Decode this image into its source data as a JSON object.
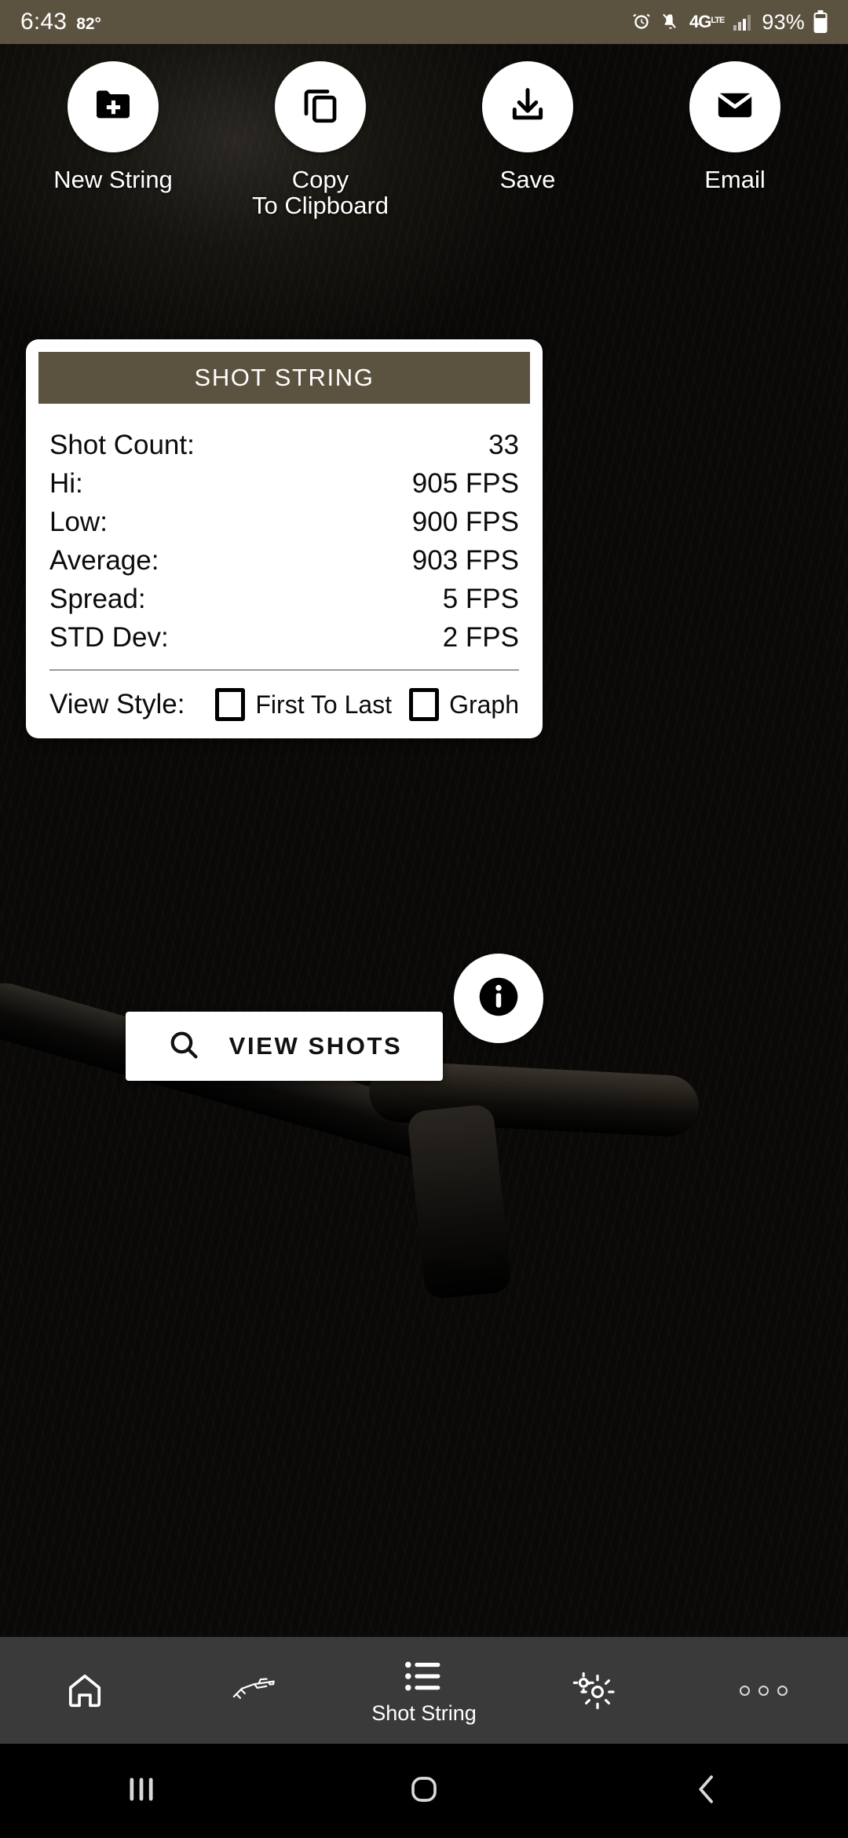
{
  "status_bar": {
    "time": "6:43",
    "temperature": "82°",
    "network": "4G",
    "network_sup": "LTE",
    "battery_percent": "93%",
    "icons": [
      "alarm-icon",
      "mute-icon",
      "network-4glte-icon",
      "signal-bars-icon",
      "battery-icon"
    ]
  },
  "actions": [
    {
      "label": "New String",
      "icon": "folder-plus-icon"
    },
    {
      "label": "Copy\nTo Clipboard",
      "icon": "copy-icon"
    },
    {
      "label": "Save",
      "icon": "download-icon"
    },
    {
      "label": "Email",
      "icon": "envelope-icon"
    }
  ],
  "card": {
    "title": "SHOT STRING",
    "header_color": "#5c5240",
    "stats": [
      {
        "label": "Shot Count:",
        "value": "33"
      },
      {
        "label": "Hi:",
        "value": "905 FPS"
      },
      {
        "label": "Low:",
        "value": "900 FPS"
      },
      {
        "label": "Average:",
        "value": "903 FPS"
      },
      {
        "label": "Spread:",
        "value": "5 FPS"
      },
      {
        "label": "STD Dev:",
        "value": "2 FPS"
      }
    ],
    "view_style": {
      "label": "View Style:",
      "options": [
        {
          "label": "First To Last",
          "checked": false
        },
        {
          "label": "Graph",
          "checked": false
        }
      ]
    }
  },
  "view_shots_button": {
    "label": "VIEW SHOTS",
    "icon": "search-icon"
  },
  "info_fab": {
    "icon": "info-icon"
  },
  "tabbar": {
    "items": [
      {
        "label": "",
        "icon": "home-icon",
        "active": false
      },
      {
        "label": "",
        "icon": "rifle-icon",
        "active": false
      },
      {
        "label": "Shot String",
        "icon": "list-icon",
        "active": true
      },
      {
        "label": "",
        "icon": "gear-icon",
        "active": false
      },
      {
        "label": "",
        "icon": "more-dots-icon",
        "active": false
      }
    ]
  },
  "system_nav": {
    "items": [
      {
        "icon": "recents-icon"
      },
      {
        "icon": "home-circle-icon"
      },
      {
        "icon": "back-icon"
      }
    ]
  }
}
